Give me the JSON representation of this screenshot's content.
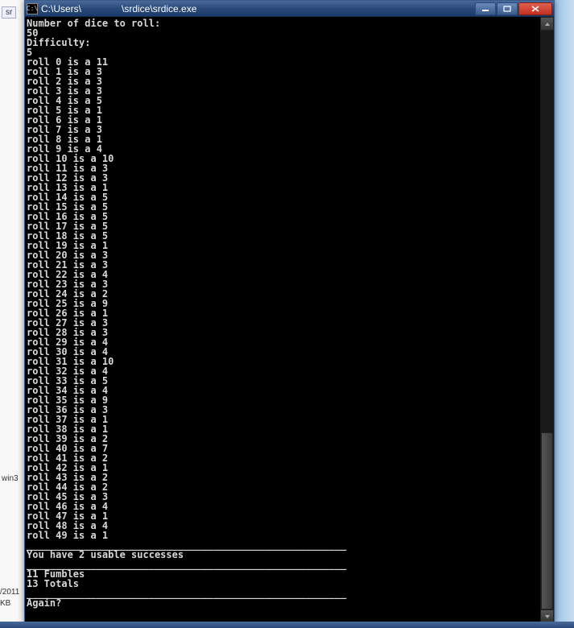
{
  "window": {
    "title": "C:\\Users\\               \\srdice\\srdice.exe",
    "icon_label": "C:\\"
  },
  "background": {
    "left_tab": "sr",
    "win3_text": "win3",
    "date_text": "/2011",
    "kb_text": "KB"
  },
  "prompts": {
    "dice_prompt": "Number of dice to roll:",
    "dice_value": "50",
    "diff_prompt": "Difficulty:",
    "diff_value": "5"
  },
  "rolls": [
    {
      "idx": 0,
      "val": 11
    },
    {
      "idx": 1,
      "val": 3
    },
    {
      "idx": 2,
      "val": 3
    },
    {
      "idx": 3,
      "val": 3
    },
    {
      "idx": 4,
      "val": 5
    },
    {
      "idx": 5,
      "val": 1
    },
    {
      "idx": 6,
      "val": 1
    },
    {
      "idx": 7,
      "val": 3
    },
    {
      "idx": 8,
      "val": 1
    },
    {
      "idx": 9,
      "val": 4
    },
    {
      "idx": 10,
      "val": 10
    },
    {
      "idx": 11,
      "val": 3
    },
    {
      "idx": 12,
      "val": 3
    },
    {
      "idx": 13,
      "val": 1
    },
    {
      "idx": 14,
      "val": 5
    },
    {
      "idx": 15,
      "val": 5
    },
    {
      "idx": 16,
      "val": 5
    },
    {
      "idx": 17,
      "val": 5
    },
    {
      "idx": 18,
      "val": 5
    },
    {
      "idx": 19,
      "val": 1
    },
    {
      "idx": 20,
      "val": 3
    },
    {
      "idx": 21,
      "val": 3
    },
    {
      "idx": 22,
      "val": 4
    },
    {
      "idx": 23,
      "val": 3
    },
    {
      "idx": 24,
      "val": 2
    },
    {
      "idx": 25,
      "val": 9
    },
    {
      "idx": 26,
      "val": 1
    },
    {
      "idx": 27,
      "val": 3
    },
    {
      "idx": 28,
      "val": 3
    },
    {
      "idx": 29,
      "val": 4
    },
    {
      "idx": 30,
      "val": 4
    },
    {
      "idx": 31,
      "val": 10
    },
    {
      "idx": 32,
      "val": 4
    },
    {
      "idx": 33,
      "val": 5
    },
    {
      "idx": 34,
      "val": 4
    },
    {
      "idx": 35,
      "val": 9
    },
    {
      "idx": 36,
      "val": 3
    },
    {
      "idx": 37,
      "val": 1
    },
    {
      "idx": 38,
      "val": 1
    },
    {
      "idx": 39,
      "val": 2
    },
    {
      "idx": 40,
      "val": 7
    },
    {
      "idx": 41,
      "val": 2
    },
    {
      "idx": 42,
      "val": 1
    },
    {
      "idx": 43,
      "val": 2
    },
    {
      "idx": 44,
      "val": 2
    },
    {
      "idx": 45,
      "val": 3
    },
    {
      "idx": 46,
      "val": 4
    },
    {
      "idx": 47,
      "val": 1
    },
    {
      "idx": 48,
      "val": 4
    },
    {
      "idx": 49,
      "val": 1
    }
  ],
  "separator": "_______________________________________________________",
  "results": {
    "success_line": "You have 2 usable successes",
    "fumbles_line": "11 Fumbles",
    "totals_line": "13 Totals",
    "again_prompt": "Again?"
  }
}
